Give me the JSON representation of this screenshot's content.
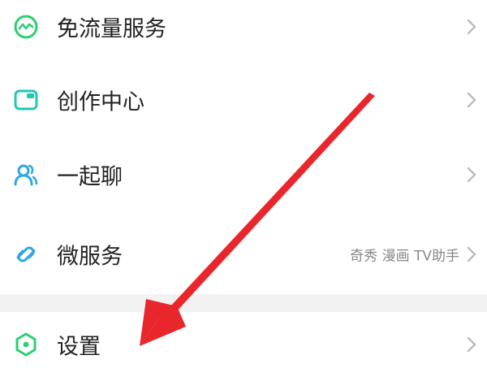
{
  "menu": {
    "items": [
      {
        "label": "免流量服务",
        "icon": "free-data-icon",
        "detail": ""
      },
      {
        "label": "创作中心",
        "icon": "creator-center-icon",
        "detail": ""
      },
      {
        "label": "一起聊",
        "icon": "chat-together-icon",
        "detail": ""
      },
      {
        "label": "微服务",
        "icon": "micro-service-icon",
        "detail": "奇秀 漫画 TV助手"
      },
      {
        "label": "设置",
        "icon": "settings-icon",
        "detail": ""
      }
    ]
  },
  "colors": {
    "icon_green": "#2ccf72",
    "icon_teal": "#21c7b5",
    "icon_blue": "#2fa7e6",
    "label": "#222222",
    "detail": "#888888",
    "chevron": "#bbbbbb",
    "section_gap": "#f2f2f2",
    "annotation_arrow": "#e8262b"
  }
}
